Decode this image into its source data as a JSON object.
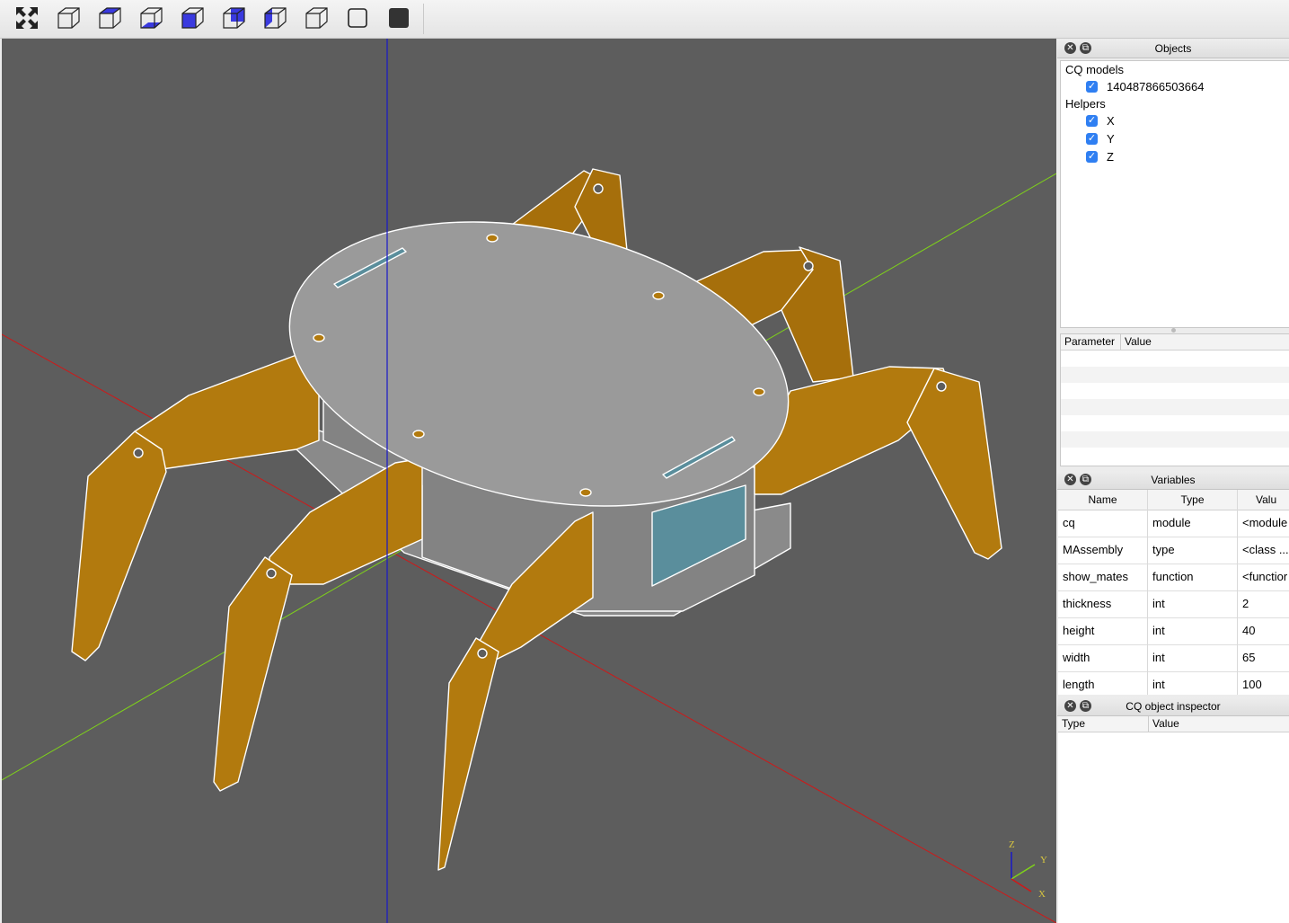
{
  "toolbar": {
    "buttons": [
      {
        "name": "fit-view-icon"
      },
      {
        "name": "iso-view-icon"
      },
      {
        "name": "top-view-icon"
      },
      {
        "name": "bottom-view-icon"
      },
      {
        "name": "front-view-icon"
      },
      {
        "name": "back-view-icon"
      },
      {
        "name": "left-view-icon"
      },
      {
        "name": "right-view-icon"
      },
      {
        "name": "wireframe-icon"
      },
      {
        "name": "shaded-icon"
      }
    ]
  },
  "viewport": {
    "triad": {
      "z": "Z",
      "y": "Y",
      "x": "X"
    },
    "colors": {
      "background": "#5d5d5d",
      "legs": "#b27a0e",
      "body": "#9b9b9b",
      "panel": "#5a8e9c",
      "x_axis": "#d01818",
      "y_axis": "#7fd21a",
      "z_axis": "#1818c8"
    }
  },
  "objects": {
    "title": "Objects",
    "groups": [
      {
        "label": "CQ models",
        "items": [
          {
            "label": "140487866503664",
            "checked": true
          }
        ]
      },
      {
        "label": "Helpers",
        "items": [
          {
            "label": "X",
            "checked": true
          },
          {
            "label": "Y",
            "checked": true
          },
          {
            "label": "Z",
            "checked": true
          }
        ]
      }
    ]
  },
  "parameters": {
    "headers": {
      "parameter": "Parameter",
      "value": "Value"
    }
  },
  "variables": {
    "title": "Variables",
    "headers": {
      "name": "Name",
      "type": "Type",
      "value": "Valu"
    },
    "rows": [
      {
        "name": "cq",
        "type": "module",
        "value": "<module"
      },
      {
        "name": "MAssembly",
        "type": "type",
        "value": "<class ..."
      },
      {
        "name": "show_mates",
        "type": "function",
        "value": "<functior"
      },
      {
        "name": "thickness",
        "type": "int",
        "value": "2"
      },
      {
        "name": "height",
        "type": "int",
        "value": "40"
      },
      {
        "name": "width",
        "type": "int",
        "value": "65"
      },
      {
        "name": "length",
        "type": "int",
        "value": "100"
      }
    ]
  },
  "inspector": {
    "title": "CQ object inspector",
    "headers": {
      "type": "Type",
      "value": "Value"
    }
  }
}
